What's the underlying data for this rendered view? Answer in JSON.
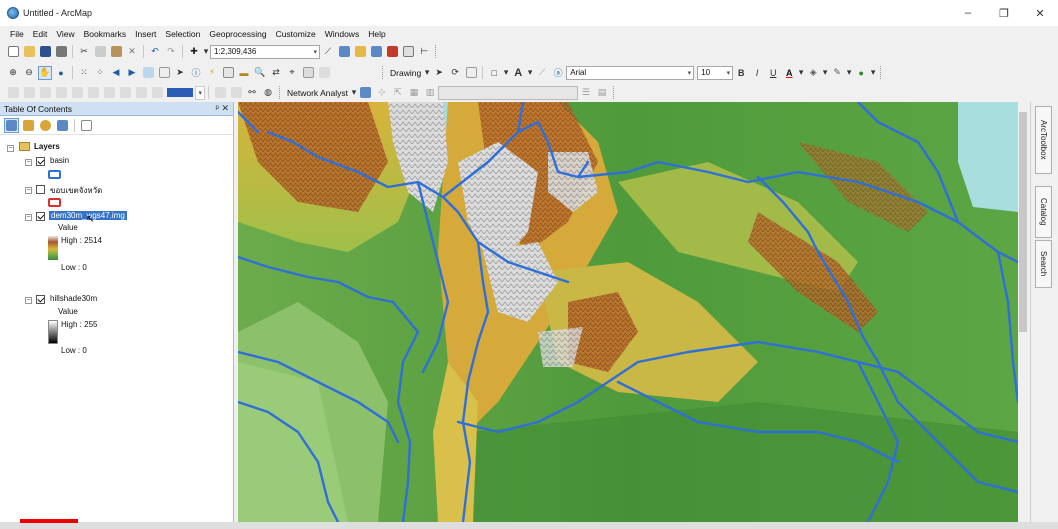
{
  "window": {
    "title": "Untitled - ArcMap",
    "controls": [
      "–",
      "❐",
      "✕"
    ]
  },
  "menu": [
    "File",
    "Edit",
    "View",
    "Bookmarks",
    "Insert",
    "Selection",
    "Geoprocessing",
    "Customize",
    "Windows",
    "Help"
  ],
  "toolbar": {
    "scale": "1:2,309,436",
    "drawing_label": "Drawing",
    "font_name": "Arial",
    "font_size": "10",
    "bold": "B",
    "italic": "I",
    "underline": "U",
    "text_tool": "A",
    "network_analyst_label": "Network Analyst"
  },
  "toc": {
    "title": "Table Of Contents",
    "pin_icons": "ᵖ ✕",
    "root": "Layers",
    "layers": [
      {
        "name": "basin",
        "checked": true,
        "symbol_color": "#2b6fd6"
      },
      {
        "name": "ขอบเขตจังหวัด",
        "checked": false,
        "symbol_color": "#d92f2f"
      },
      {
        "name": "dem30m_wgs47.img",
        "checked": true,
        "selected": true,
        "value_label": "Value",
        "high": "High : 2514",
        "low": "Low : 0"
      },
      {
        "name": "hillshade30m",
        "checked": true,
        "value_label": "Value",
        "high": "High : 255",
        "low": "Low : 0"
      }
    ]
  },
  "dock_tabs": [
    "ArcToolbox",
    "Catalog",
    "Search"
  ],
  "colors": {
    "river": "#2f6fd8",
    "selection": "#3573c6",
    "dem_low": "#4f9c3d",
    "dem_mid": "#d9b73a",
    "dem_high": "#b04a1f",
    "dem_peak": "#e4e4e4",
    "water": "#a8d8d8"
  }
}
